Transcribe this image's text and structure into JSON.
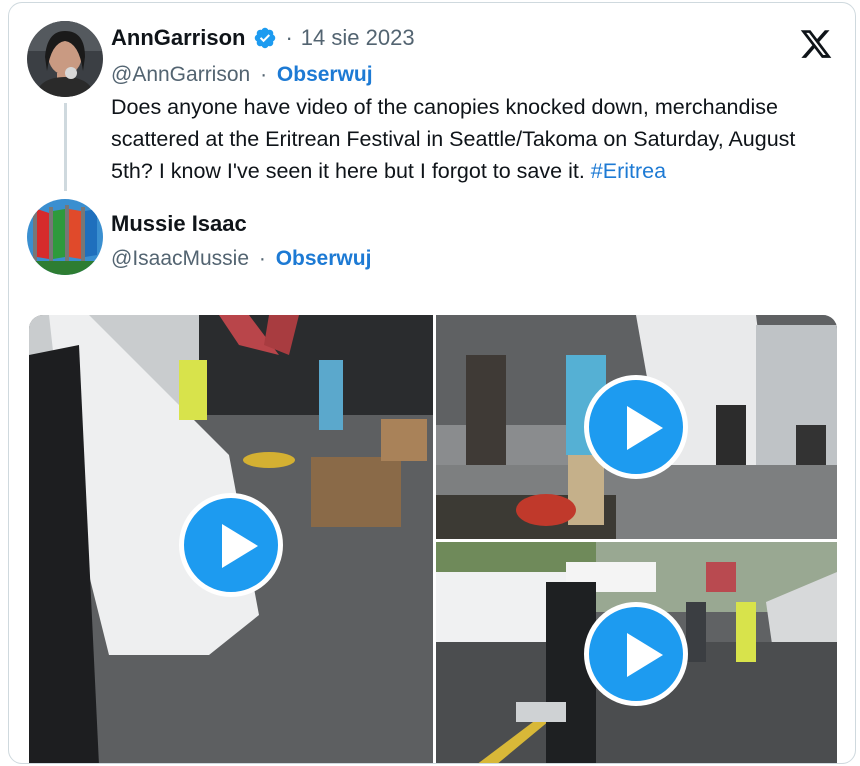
{
  "tweet1": {
    "name": "AnnGarrison",
    "date": "14 sie 2023",
    "handle": "@AnnGarrison",
    "follow": "Obserwuj",
    "text": "Does anyone have video of the canopies knocked down, merchandise scattered at the Eritrean Festival in Seattle/Takoma on Saturday, August 5th? I know I've seen it here but I forgot to save it.",
    "hashtag": "#Eritrea",
    "verified": true
  },
  "tweet2": {
    "name": "Mussie Isaac",
    "handle": "@IsaacMussie",
    "follow": "Obserwuj"
  },
  "separator": "·",
  "icons": {
    "logo": "x-logo-icon",
    "verified": "verified-badge-icon",
    "play": "play-icon"
  },
  "colors": {
    "accent": "#1d9bf0",
    "link": "#1d7ad4",
    "muted": "#536471"
  },
  "media": [
    {
      "label": "video-1"
    },
    {
      "label": "video-2"
    },
    {
      "label": "video-3"
    }
  ]
}
